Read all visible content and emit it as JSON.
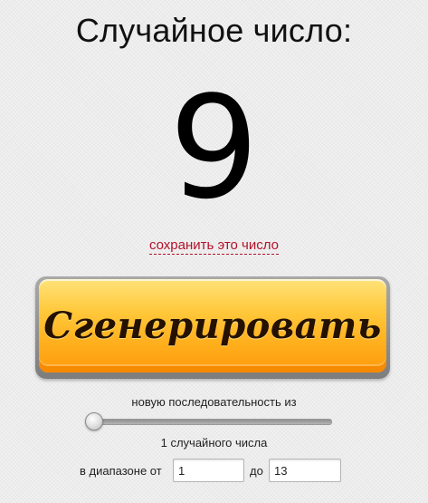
{
  "header": {
    "title": "Случайное число:"
  },
  "result": {
    "value": "9"
  },
  "save_link": {
    "label": "сохранить это число"
  },
  "generate_button": {
    "label": "Сгенерировать"
  },
  "sequence": {
    "label": "новую последовательность из",
    "count_text": "1 случайного числа",
    "slider_value": 1
  },
  "range": {
    "from_label": "в диапазоне от",
    "from_value": "1",
    "to_label": "до",
    "to_value": "13"
  },
  "colors": {
    "accent_link": "#b3122a",
    "button_top": "#ffe37a",
    "button_bottom": "#ff9a0c",
    "background": "#ececec"
  }
}
